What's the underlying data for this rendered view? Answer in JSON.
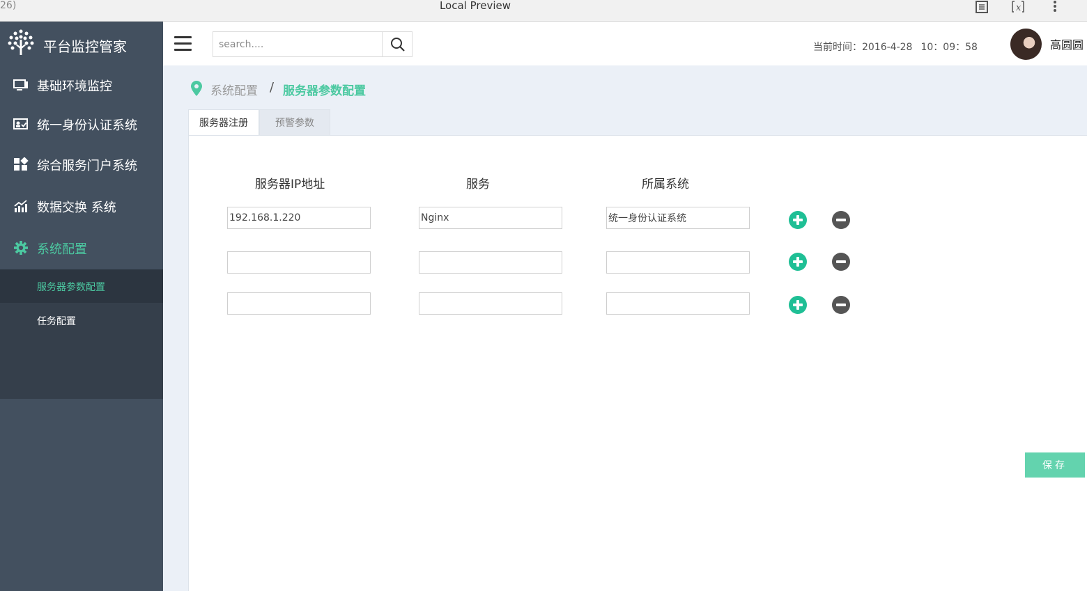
{
  "window": {
    "title": "Local Preview",
    "tab_fragment": "26)",
    "icons": [
      "reader-icon",
      "formula-icon",
      "more-vertical-icon"
    ]
  },
  "sidebar": {
    "logo_text": "平台监控管家",
    "items": [
      {
        "label": "基础环境监控",
        "icon": "monitor-icon"
      },
      {
        "label": "统一身份认证系统",
        "icon": "id-card-icon"
      },
      {
        "label": "综合服务门户系统",
        "icon": "dashboard-icon"
      },
      {
        "label": "数据交换 系统",
        "icon": "chart-icon"
      },
      {
        "label": "系统配置",
        "icon": "gear-icon",
        "active": true
      }
    ],
    "subitems": [
      {
        "label": "服务器参数配置",
        "active": true
      },
      {
        "label": "任务配置"
      }
    ]
  },
  "header": {
    "search_placeholder": "search....",
    "clock_label": "当前时间：2016-4-28",
    "clock_time": "10：09：58",
    "username": "高圆圆"
  },
  "breadcrumb": {
    "parent": "系统配置",
    "separator": "/",
    "current": "服务器参数配置"
  },
  "tabs": [
    {
      "label": "服务器注册",
      "active": true
    },
    {
      "label": "预警参数"
    }
  ],
  "form": {
    "columns": [
      "服务器IP地址",
      "服务",
      "所属系统"
    ],
    "rows": [
      {
        "ip": "192.168.1.220",
        "service": "Nginx",
        "system": "统一身份认证系统"
      },
      {
        "ip": "",
        "service": "",
        "system": ""
      },
      {
        "ip": "",
        "service": "",
        "system": ""
      }
    ],
    "save_label": "保存"
  },
  "colors": {
    "accent": "#4cc9a1",
    "add_button": "#1fbf95",
    "remove_button": "#555555",
    "save_button": "#63d3ae",
    "sidebar": "#43505f",
    "submenu": "#353f4b",
    "content_bg": "#ebf0f7"
  }
}
